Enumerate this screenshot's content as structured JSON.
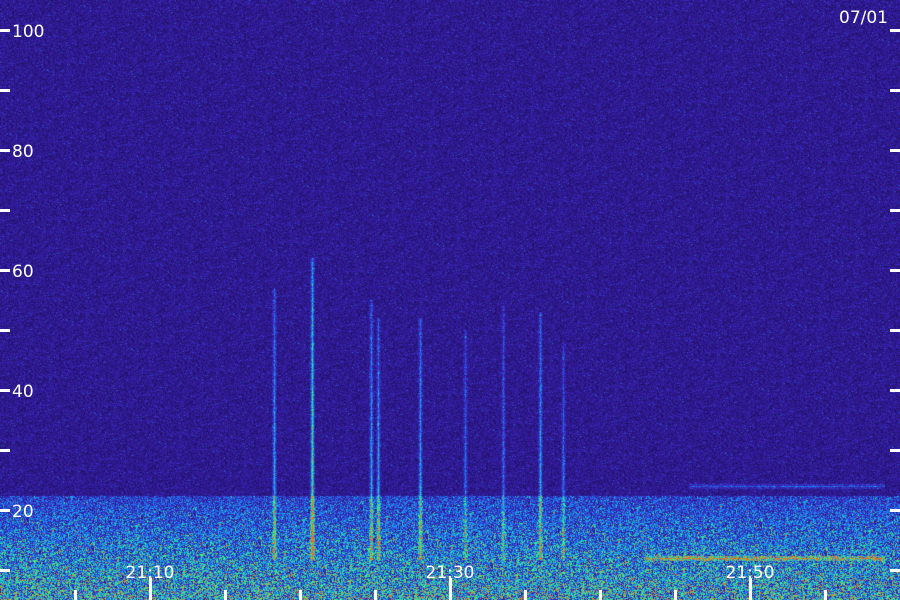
{
  "chart_data": {
    "type": "heatmap",
    "title": "",
    "xlabel": "",
    "ylabel": "",
    "date_label": "07/01",
    "ylim": [
      10,
      105
    ],
    "y_major_ticks": [
      20,
      40,
      60,
      80,
      100
    ],
    "y_tick_labels": [
      "20",
      "40",
      "60",
      "80",
      "100"
    ],
    "y_minor_ticks": [
      10,
      30,
      50,
      70,
      90
    ],
    "x_range_minutes": [
      "21:04",
      "21:59"
    ],
    "x_major_ticks": [
      "21:10",
      "21:30",
      "21:50"
    ],
    "x_tick_labels": [
      "21:10",
      "21:30",
      "21:50"
    ],
    "x_minor_tick_interval_minutes": 5,
    "background_level": "low",
    "colors": {
      "background": "#2a1470",
      "low": "#3a22b0",
      "mid": "#1aa6ff",
      "high": "#3fff7a",
      "peak": "#ff5a1a",
      "labels": "#ffffff"
    },
    "vertical_events": [
      {
        "time": "21:18.3",
        "top_value": 57,
        "intensity": "medium"
      },
      {
        "time": "21:20.8",
        "top_value": 62,
        "intensity": "high"
      },
      {
        "time": "21:24.7",
        "top_value": 55,
        "intensity": "medium"
      },
      {
        "time": "21:25.2",
        "top_value": 52,
        "intensity": "medium"
      },
      {
        "time": "21:28.0",
        "top_value": 52,
        "intensity": "medium"
      },
      {
        "time": "21:31.0",
        "top_value": 50,
        "intensity": "low"
      },
      {
        "time": "21:33.5",
        "top_value": 54,
        "intensity": "low"
      },
      {
        "time": "21:36.0",
        "top_value": 53,
        "intensity": "medium"
      },
      {
        "time": "21:37.5",
        "top_value": 48,
        "intensity": "low"
      }
    ],
    "horizontal_bands": [
      {
        "from": "21:43",
        "to": "21:59",
        "value": 12,
        "intensity": "high"
      },
      {
        "from": "21:46",
        "to": "21:59",
        "value": 24,
        "intensity": "low"
      }
    ]
  }
}
